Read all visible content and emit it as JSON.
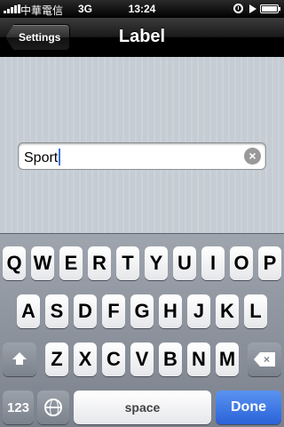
{
  "status_bar": {
    "carrier": "中華電信",
    "network": "3G",
    "time": "13:24",
    "icons": [
      "signal-icon",
      "clock-icon",
      "play-icon",
      "battery-icon"
    ]
  },
  "nav": {
    "back_label": "Settings",
    "title": "Label"
  },
  "field": {
    "value": "Sport",
    "clear_icon": "clear-icon"
  },
  "keyboard": {
    "row1": [
      "Q",
      "W",
      "E",
      "R",
      "T",
      "Y",
      "U",
      "I",
      "O",
      "P"
    ],
    "row2": [
      "A",
      "S",
      "D",
      "F",
      "G",
      "H",
      "J",
      "K",
      "L"
    ],
    "row3": [
      "Z",
      "X",
      "C",
      "V",
      "B",
      "N",
      "M"
    ],
    "shift_icon": "shift-icon",
    "delete_icon": "delete-icon",
    "numbers_label": "123",
    "globe_icon": "globe-icon",
    "space_label": "space",
    "done_label": "Done"
  },
  "colors": {
    "done_key": "#2a62d8",
    "caret": "#3a6fd8",
    "content_bg": "#c5ccd4"
  }
}
